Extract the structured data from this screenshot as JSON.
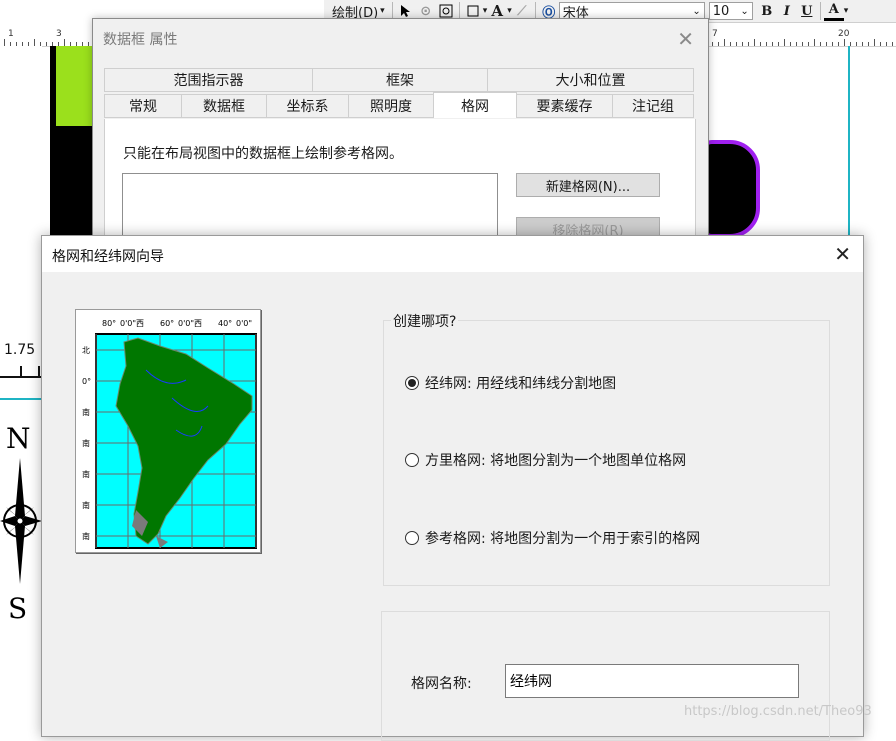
{
  "toolbar": {
    "draw_menu": "绘制(D)",
    "font_name": "宋体",
    "font_size": "10",
    "bold": "B",
    "italic": "I",
    "underline": "U",
    "font_color": "A",
    "text_tool": "A"
  },
  "ruler": {
    "labels": [
      "1",
      "3",
      "7",
      "20"
    ]
  },
  "layout": {
    "scale_value": "1.75",
    "north_letter": "N",
    "south_letter": "S"
  },
  "properties_dialog": {
    "title": "数据框 属性",
    "tabs_row1": [
      "范围指示器",
      "框架",
      "大小和位置"
    ],
    "tabs_row2": [
      "常规",
      "数据框",
      "坐标系",
      "照明度",
      "格网",
      "要素缓存",
      "注记组"
    ],
    "active_tab": "格网",
    "hint": "只能在布局视图中的数据框上绘制参考格网。",
    "new_grid_button": "新建格网(N)...",
    "remove_grid_button": "移除格网(R)"
  },
  "wizard": {
    "title": "格网和经纬网向导",
    "preview": {
      "top_labels": [
        "80°",
        "0'0\"西",
        "60°",
        "0'0\"西",
        "40°",
        "0'0\""
      ],
      "left_labels": [
        "北",
        "0°",
        "南",
        "南",
        "南",
        "南",
        "南"
      ]
    },
    "create_group_label": "创建哪项?",
    "options": [
      {
        "label": "经纬网: 用经线和纬线分割地图",
        "selected": true
      },
      {
        "label": "方里格网: 将地图分割为一个地图单位格网",
        "selected": false
      },
      {
        "label": "参考格网: 将地图分割为一个用于索引的格网",
        "selected": false
      }
    ],
    "grid_name_label": "格网名称:",
    "grid_name_value": "经纬网"
  },
  "watermark": "https://blog.csdn.net/Theo93",
  "colors": {
    "ocean": "#00ffff",
    "land": "#007700",
    "graticule": "#555555",
    "accent_cyan": "#1fb4c4",
    "accent_purple": "#a020f0"
  }
}
